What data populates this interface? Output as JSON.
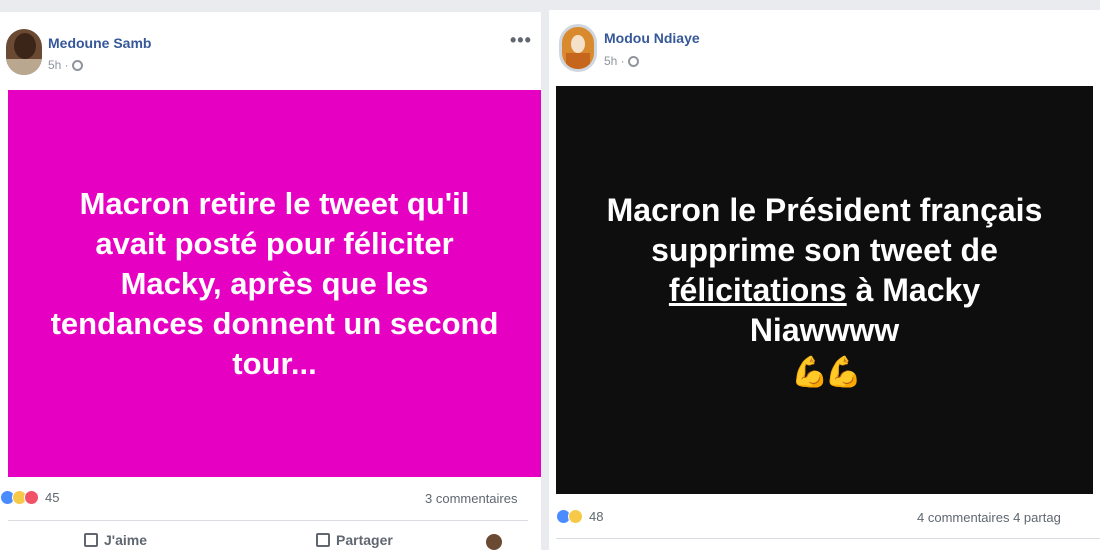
{
  "left_post": {
    "author": "Medoune Samb",
    "time": "5h ·",
    "more_label": "•••",
    "banner_lines": [
      "Macron retire le tweet qu'il",
      "avait posté pour féliciter",
      "Macky, après que les",
      "tendances donnent un second",
      "tour..."
    ],
    "banner_color": "#e500c2",
    "reaction_count": "45",
    "comments": "3 commentaires",
    "actions": {
      "like": "J'aime",
      "share": "Partager"
    }
  },
  "right_post": {
    "author": "Modou Ndiaye",
    "time": "5h ·",
    "banner_line1": "Macron le Président français",
    "banner_line2": "supprime son tweet de",
    "banner_line3_underlined": "félicitations",
    "banner_line3_rest": " à Macky",
    "banner_line4": "Niawwww",
    "banner_emoji": "💪💪",
    "banner_color": "#0e0e0e",
    "reaction_count": "48",
    "comments": "4 commentaires  4 partag"
  },
  "icons": [
    "globe-icon",
    "more-icon",
    "like-reaction-icon",
    "haha-reaction-icon",
    "love-reaction-icon",
    "like-icon",
    "share-icon"
  ]
}
